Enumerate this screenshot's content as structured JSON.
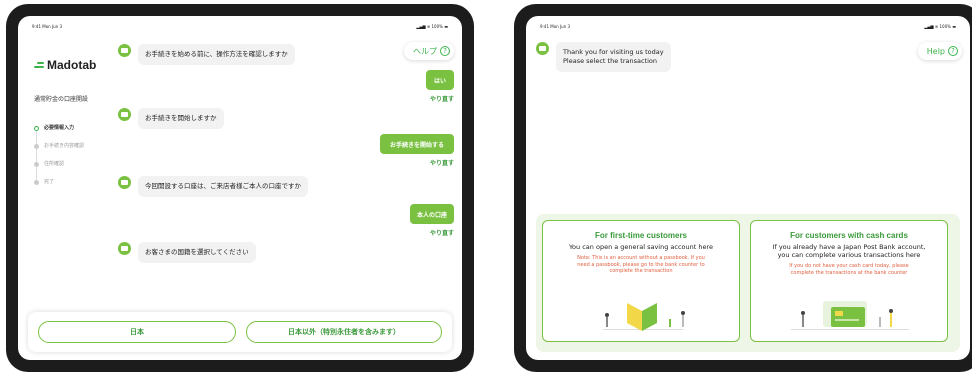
{
  "left_screen": {
    "status_time": "9:41  Mon Jun 3",
    "status_sys": "▂▄▆ ≋ 100% ▬",
    "logo": "Madotab",
    "account_title": "通常貯金の口座開設",
    "steps": [
      {
        "label": "必要情報入力"
      },
      {
        "label": "お手続き内容確認"
      },
      {
        "label": "住所確認"
      },
      {
        "label": "完了"
      }
    ],
    "help": {
      "label": "ヘルプ",
      "icon": "?"
    },
    "messages": [
      {
        "text": "お手続きを始める前に、操作方法を確認しますか"
      },
      {
        "text": "お手続きを開始しますか"
      },
      {
        "text": "今回開設する口座は、ご来店者様ご本人の口座ですか"
      },
      {
        "text": "お客さまの国籍を選択してください"
      }
    ],
    "replies": [
      {
        "label": "はい",
        "redo": "やり直す"
      },
      {
        "label": "お手続きを開始する",
        "redo": "やり直す"
      },
      {
        "label": "本人の口座",
        "redo": "やり直す"
      }
    ],
    "choices": [
      {
        "label": "日本"
      },
      {
        "label": "日本以外（特別永住者を含みます）"
      }
    ]
  },
  "right_screen": {
    "status_time": "9:41  Mon Jun 3",
    "status_sys": "▂▄▆ ≋ 100% ▬",
    "help": {
      "label": "Help",
      "icon": "?"
    },
    "message": "Thank you for visiting us today\nPlease select the transaction",
    "cards": [
      {
        "title": "For first-time customers",
        "subtitle": "You can open a general saving account here",
        "note": "Note: This is an account without a passbook. If you\nneed a passbook, please go to the bank counter to\ncomplete the transaction"
      },
      {
        "title": "For customers with cash cards",
        "subtitle": "If you already have a Japan Post Bank account,\nyou can complete various transactions here",
        "note": "If you do not have your cash card today, please\ncomplete the transactions at the bank counter"
      }
    ]
  },
  "colors": {
    "accent": "#7ac142",
    "accent_dark": "#3a9a3a",
    "note": "#e06040",
    "bubble": "#f2f2f2",
    "bezel": "#1c1c1c"
  }
}
